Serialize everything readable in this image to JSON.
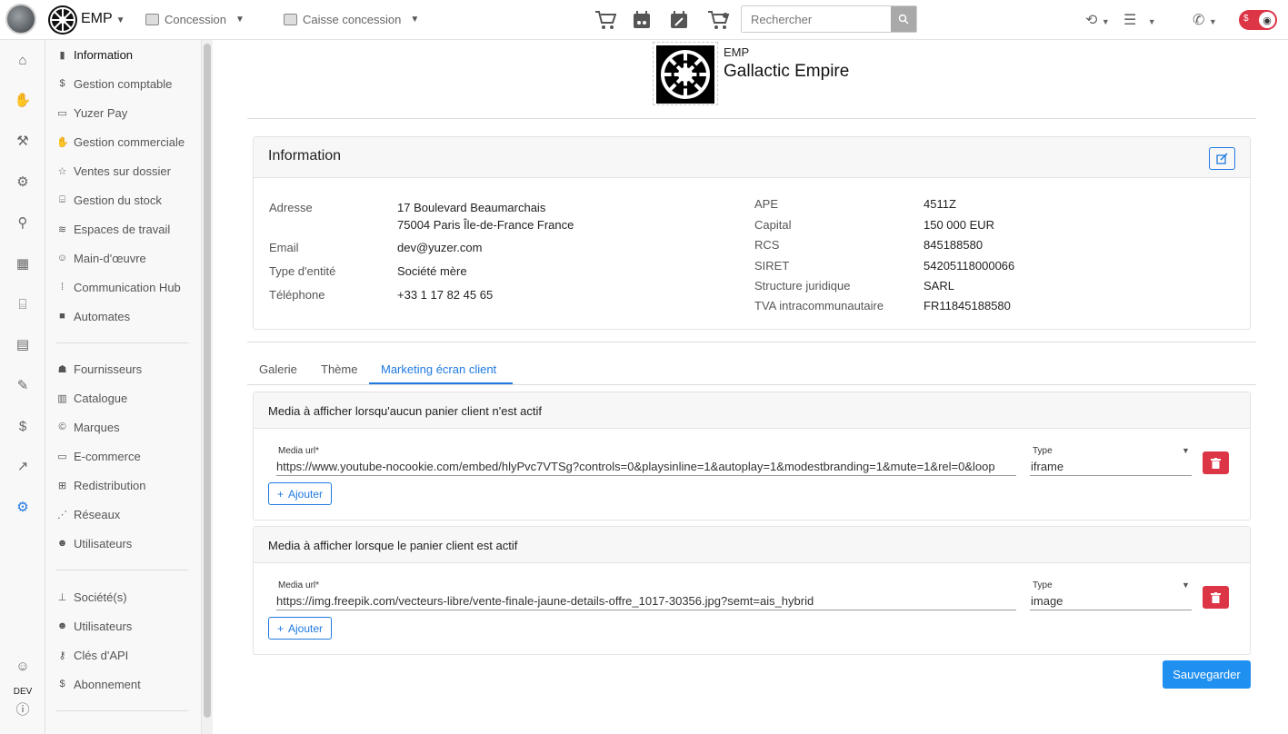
{
  "topbar": {
    "org_code": "EMP",
    "menu1": "Concession",
    "menu2": "Caisse concession",
    "search_placeholder": "Rechercher",
    "toggle_label": "$"
  },
  "rail": {
    "env_label": "DEV"
  },
  "sidebar": {
    "group1": [
      {
        "label": "Information",
        "icon": "building-icon"
      },
      {
        "label": "Gestion comptable",
        "icon": "dollar-icon"
      },
      {
        "label": "Yuzer Pay",
        "icon": "card-icon"
      },
      {
        "label": "Gestion commerciale",
        "icon": "handshake-icon"
      },
      {
        "label": "Ventes sur dossier",
        "icon": "star-icon"
      },
      {
        "label": "Gestion du stock",
        "icon": "warehouse-icon"
      },
      {
        "label": "Espaces de travail",
        "icon": "layers-icon"
      },
      {
        "label": "Main-d'œuvre",
        "icon": "users-cog-icon"
      },
      {
        "label": "Communication Hub",
        "icon": "broadcast-icon"
      },
      {
        "label": "Automates",
        "icon": "robot-icon"
      }
    ],
    "group2": [
      {
        "label": "Fournisseurs",
        "icon": "supplier-icon"
      },
      {
        "label": "Catalogue",
        "icon": "books-icon"
      },
      {
        "label": "Marques",
        "icon": "copyright-icon"
      },
      {
        "label": "E-commerce",
        "icon": "browser-icon"
      },
      {
        "label": "Redistribution",
        "icon": "network-icon"
      },
      {
        "label": "Réseaux",
        "icon": "nodes-icon"
      },
      {
        "label": "Utilisateurs",
        "icon": "users-icon"
      }
    ],
    "group3": [
      {
        "label": "Société(s)",
        "icon": "sitemap-icon"
      },
      {
        "label": "Utilisateurs",
        "icon": "users-icon"
      },
      {
        "label": "Clés d'API",
        "icon": "key-icon"
      },
      {
        "label": "Abonnement",
        "icon": "dollar-icon"
      }
    ]
  },
  "company": {
    "code": "EMP",
    "name": "Gallactic Empire"
  },
  "info": {
    "title": "Information",
    "left": [
      {
        "label": "Adresse",
        "value": "17 Boulevard Beaumarchais",
        "value2": "75004 Paris Île-de-France France"
      },
      {
        "label": "Email",
        "value": "dev@yuzer.com"
      },
      {
        "label": "Type d'entité",
        "value": "Société mère"
      },
      {
        "label": "Téléphone",
        "value": "+33 1 17 82 45 65"
      }
    ],
    "right": [
      {
        "label": "APE",
        "value": "4511Z"
      },
      {
        "label": "Capital",
        "value": "150 000 EUR"
      },
      {
        "label": "RCS",
        "value": "845188580"
      },
      {
        "label": "SIRET",
        "value": "54205118000066"
      },
      {
        "label": "Structure juridique",
        "value": "SARL"
      },
      {
        "label": "TVA intracommunautaire",
        "value": "FR11845188580"
      }
    ]
  },
  "tabs": [
    "Galerie",
    "Thème",
    "Marketing écran client"
  ],
  "marketing": {
    "sections": [
      {
        "title": "Media à afficher lorsqu'aucun panier client n'est actif",
        "url_label": "Media url*",
        "url": "https://www.youtube-nocookie.com/embed/hlyPvc7VTSg?controls=0&playsinline=1&autoplay=1&modestbranding=1&mute=1&rel=0&loop",
        "type_label": "Type",
        "type": "iframe",
        "add_label": "Ajouter"
      },
      {
        "title": "Media à afficher lorsque le panier client est actif",
        "url_label": "Media url*",
        "url": "https://img.freepik.com/vecteurs-libre/vente-finale-jaune-details-offre_1017-30356.jpg?semt=ais_hybrid",
        "type_label": "Type",
        "type": "image",
        "add_label": "Ajouter"
      }
    ],
    "save_label": "Sauvegarder"
  },
  "colors": {
    "accent": "#1f7ae0",
    "danger": "#dc3545",
    "save": "#1f8ff0"
  }
}
